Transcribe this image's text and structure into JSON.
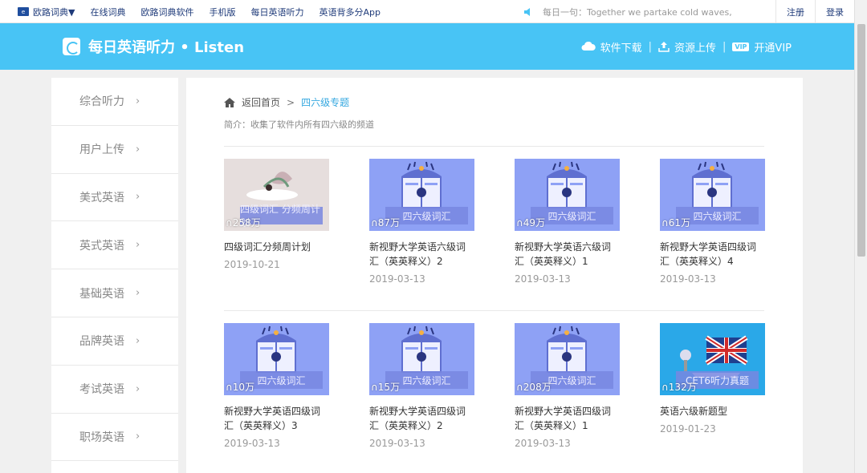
{
  "topbar": {
    "brand": "欧路词典▼",
    "links": [
      "在线词典",
      "欧路词典软件",
      "手机版",
      "每日英语听力",
      "英语背多分App"
    ],
    "daily_sentence": "每日一句：Together we partake cold waves,",
    "register": "注册",
    "login": "登录"
  },
  "header": {
    "title": "每日英语听力 • Listen",
    "actions": {
      "download": "软件下载",
      "upload": "资源上传",
      "vip": "开通VIP",
      "vip_badge": "VIP",
      "separator": "|"
    }
  },
  "sidebar": {
    "items": [
      "综合听力",
      "用户上传",
      "美式英语",
      "英式英语",
      "基础英语",
      "品牌英语",
      "考试英语",
      "职场英语"
    ],
    "chevron": "›"
  },
  "breadcrumb": {
    "home": "返回首页",
    "separator": ">",
    "current": "四六级专题"
  },
  "intro": "简介：收集了软件内所有四六级的频道",
  "cards": [
    {
      "title": "四级词汇分频周计划",
      "date": "2019-10-21",
      "plays": "258万",
      "thumb_text": "四级词汇 分频周计划"
    },
    {
      "title": "新视野大学英语六级词汇（英英释义）2",
      "date": "2019-03-13",
      "plays": "87万",
      "thumb_text": "四六级词汇"
    },
    {
      "title": "新视野大学英语六级词汇（英英释义）1",
      "date": "2019-03-13",
      "plays": "49万",
      "thumb_text": "四六级词汇"
    },
    {
      "title": "新视野大学英语四级词汇（英英释义）4",
      "date": "2019-03-13",
      "plays": "61万",
      "thumb_text": "四六级词汇"
    },
    {
      "title": "新视野大学英语四级词汇（英英释义）3",
      "date": "2019-03-13",
      "plays": "10万",
      "thumb_text": "四六级词汇"
    },
    {
      "title": "新视野大学英语四级词汇（英英释义）2",
      "date": "2019-03-13",
      "plays": "15万",
      "thumb_text": "四六级词汇"
    },
    {
      "title": "新视野大学英语四级词汇（英英释义）1",
      "date": "2019-03-13",
      "plays": "208万",
      "thumb_text": "四六级词汇"
    },
    {
      "title": "英语六级新题型",
      "date": "2019-01-23",
      "plays": "132万",
      "thumb_text": "CET6听力真题"
    }
  ],
  "colors": {
    "header_bg": "#48c4f5",
    "accent": "#35a8e0",
    "thumb_bg": "#8ea1f5"
  },
  "icons": {
    "speaker": "speaker-icon",
    "home": "home-icon",
    "cloud": "cloud-download-icon",
    "upload": "upload-icon",
    "headphone": "headphone-icon"
  }
}
